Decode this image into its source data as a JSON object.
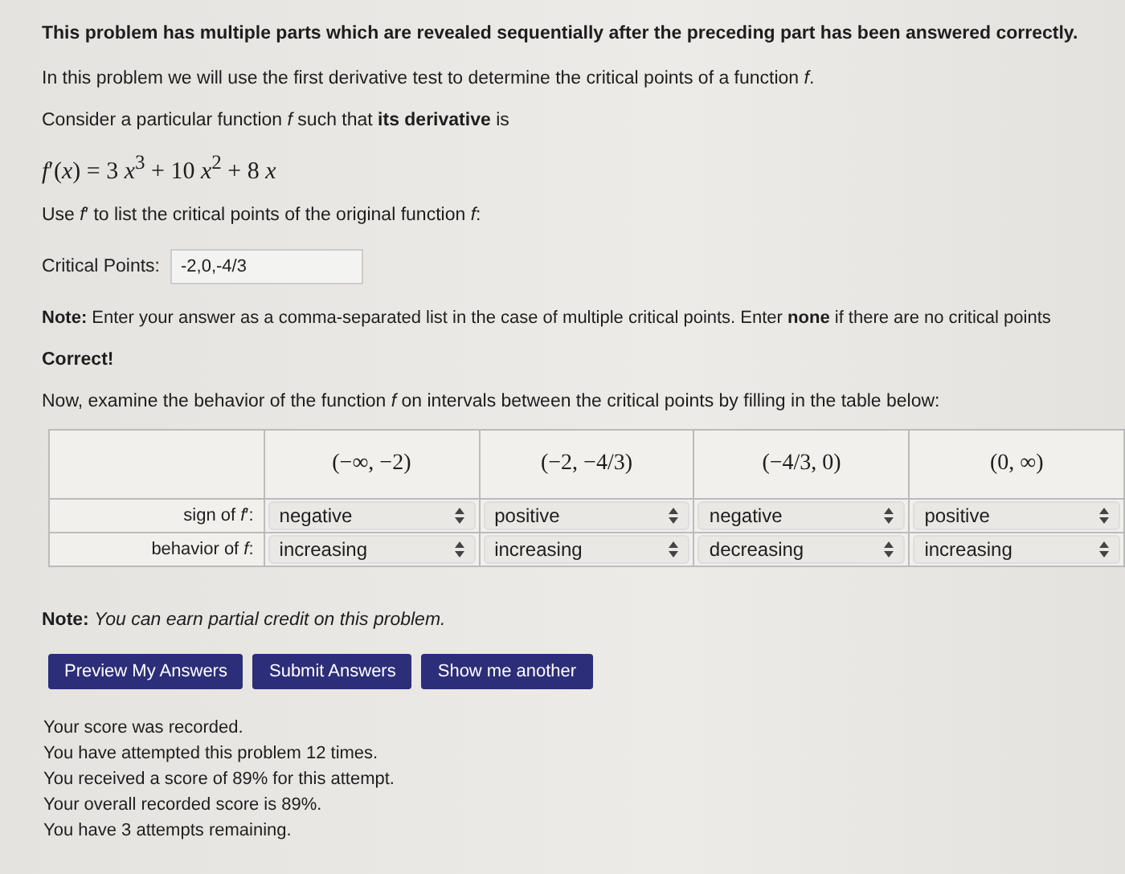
{
  "header": "This problem has multiple parts which are revealed sequentially after the preceding part has been answered correctly.",
  "paragraphs": [
    "In this problem we will use the first derivative test to determine the critical points of a function *f*.",
    "Consider a particular function *f* such that **its derivative** is"
  ],
  "formula": "*f*′(*x*) = 3 *x*$^{3}$ + 10 *x*$^{2}$ + 8 *x*",
  "instruction": "Use *f*′ to list the critical points of the original function *f*:",
  "answer": {
    "label": "Critical Points:",
    "value": "-2,0,-4/3"
  },
  "note": "**Note:** Enter your answer as a comma-separated list in the case of multiple critical points. Enter **none** if there are no critical points",
  "result": "Correct!",
  "table_intro": "Now, examine the behavior of the function *f* on intervals between the critical points by filling in the table below:",
  "table": {
    "columns": [
      "(−∞, −2)",
      "(−2, −4/3)",
      "(−4/3, 0)",
      "(0, ∞)"
    ],
    "rows": [
      {
        "label": "sign of *f*′:",
        "cells": [
          "negative",
          "positive",
          "negative",
          "positive"
        ]
      },
      {
        "label": "behavior of *f*:",
        "cells": [
          "increasing",
          "increasing",
          "decreasing",
          "increasing"
        ]
      }
    ]
  },
  "credit_note": "**Note:** *You can earn partial credit on this problem.*",
  "buttons": [
    "Preview My Answers",
    "Submit Answers",
    "Show me another"
  ],
  "score_lines": [
    "Your score was recorded.",
    "You have attempted this problem 12 times.",
    "You received a score of 89% for this attempt.",
    "Your overall recorded score is 89%.",
    "You have 3 attempts remaining."
  ]
}
